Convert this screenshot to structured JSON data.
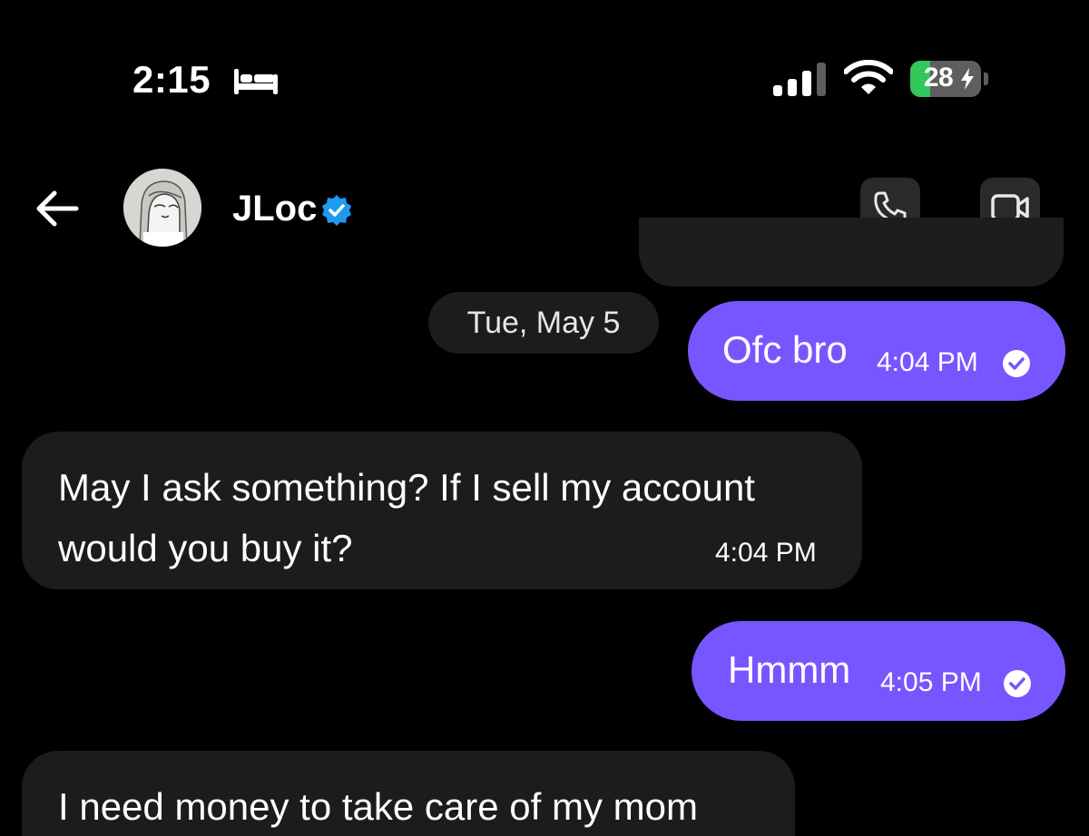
{
  "status_bar": {
    "time": "2:15",
    "battery_level": "28",
    "battery_fraction": 0.28,
    "icons": [
      "bed-icon",
      "cellular-signal-icon",
      "wifi-icon",
      "battery-icon",
      "charging-bolt-icon"
    ]
  },
  "header": {
    "contact_name": "JLoc",
    "icons": [
      "back-arrow-icon",
      "avatar",
      "verified-badge-icon",
      "phone-icon",
      "video-camera-icon"
    ]
  },
  "date_separator": "Tue, May 5",
  "messages": [
    {
      "direction": "sent",
      "text": "Ofc bro",
      "time": "4:04 PM",
      "status": "read"
    },
    {
      "direction": "received",
      "lines": [
        "May I ask something? If I sell my account",
        "would you buy it?"
      ],
      "time": "4:04 PM"
    },
    {
      "direction": "sent",
      "text": "Hmmm",
      "time": "4:05 PM",
      "status": "read"
    },
    {
      "direction": "received",
      "lines": [
        "I need money to take care of my mom"
      ]
    }
  ],
  "colors": {
    "background": "#000000",
    "sent_bubble": "#7856ff",
    "received_bubble": "#1c1c1f",
    "verified_badge": "#1d9bf0",
    "battery_green": "#34c759"
  }
}
